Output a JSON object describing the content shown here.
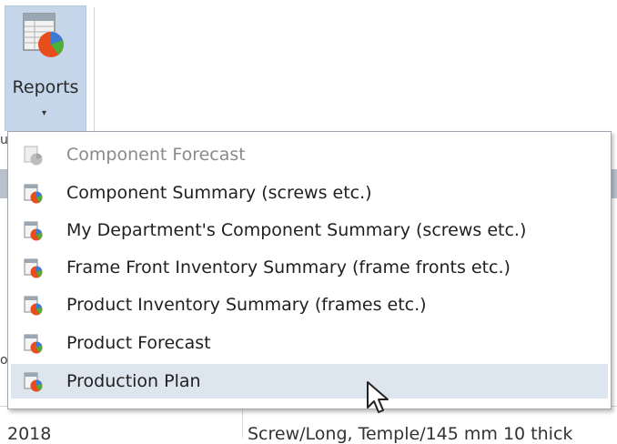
{
  "ribbon": {
    "reports_button": {
      "label": "Reports",
      "icon": "reports-chart-icon",
      "caret": "▾"
    }
  },
  "background": {
    "stub_top": "u",
    "stub_mid": "o",
    "row": {
      "year": "2018",
      "description": "Screw/Long, Temple/145 mm 10 thick"
    }
  },
  "menu": {
    "items": [
      {
        "label": "Component Forecast",
        "icon": "report-icon",
        "disabled": true
      },
      {
        "label": "Component Summary (screws etc.)",
        "icon": "report-icon"
      },
      {
        "label": "My Department's Component Summary (screws etc.)",
        "icon": "report-icon"
      },
      {
        "label": "Frame Front Inventory Summary (frame fronts etc.)",
        "icon": "report-icon"
      },
      {
        "label": "Product Inventory Summary (frames etc.)",
        "icon": "report-icon"
      },
      {
        "label": "Product Forecast",
        "icon": "report-icon"
      },
      {
        "label": "Production Plan",
        "icon": "report-icon",
        "highlighted": true
      }
    ]
  },
  "colors": {
    "ribbon_button_bg": "#c5d6ea",
    "menu_highlight": "#dde5ef",
    "disabled_text": "#8a8a8a"
  }
}
